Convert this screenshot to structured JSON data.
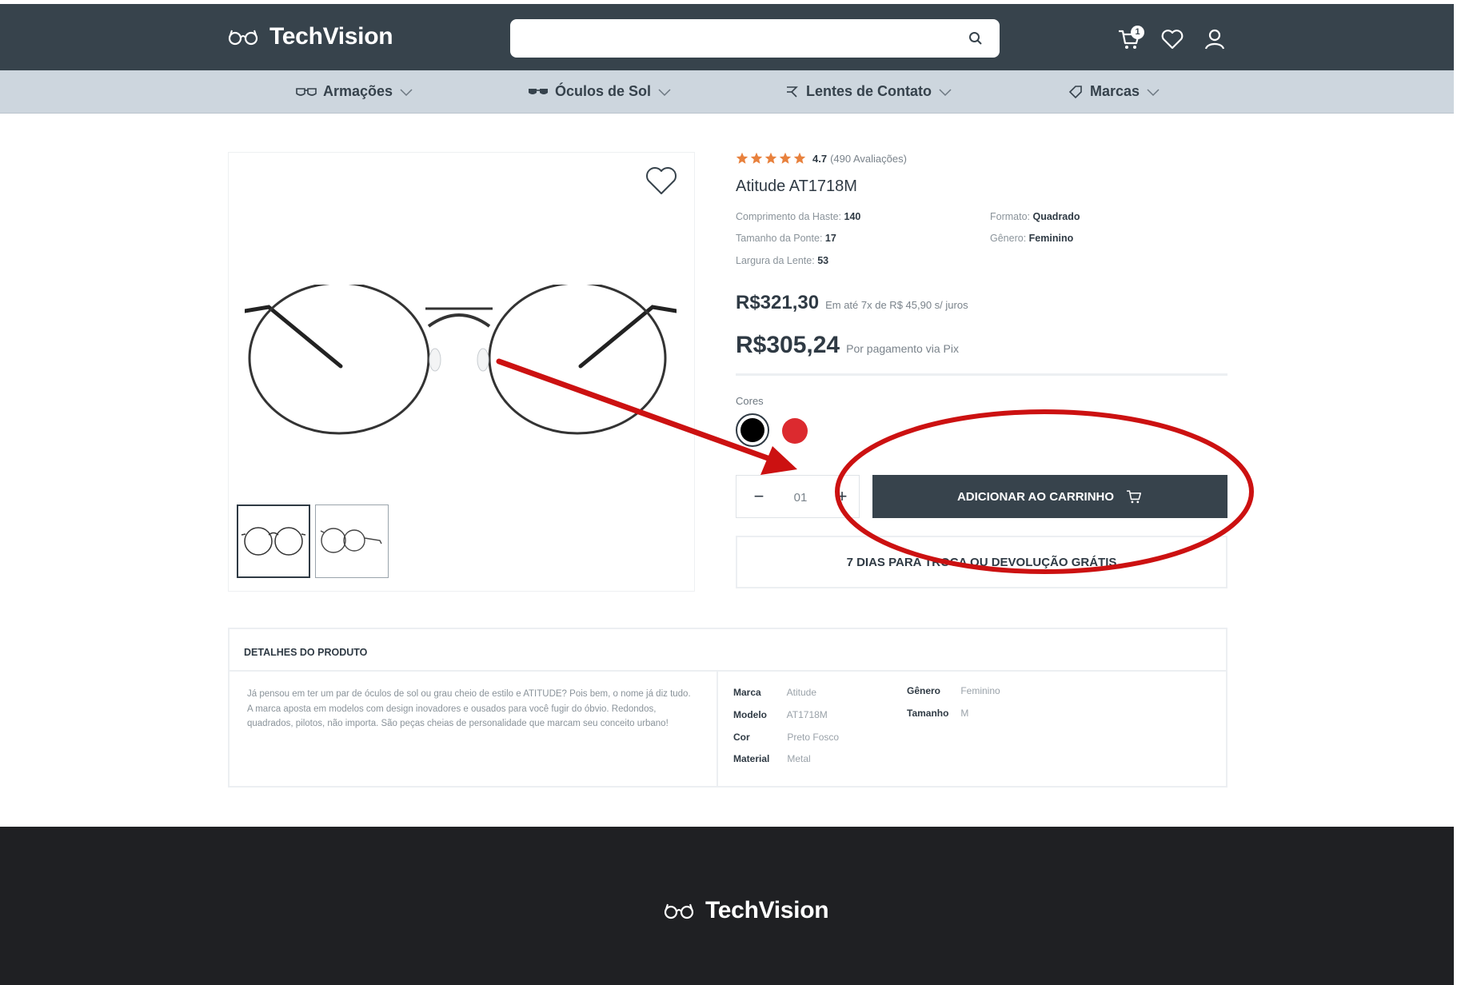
{
  "header": {
    "brand": "TechVision",
    "search_placeholder": "",
    "cart_count": "1"
  },
  "icons": {
    "logo": "glasses-icon",
    "search": "search-icon",
    "cart": "cart-icon",
    "wishlist": "heart-icon",
    "account": "user-icon"
  },
  "categories": [
    {
      "label": "Armações",
      "icon": "frames-icon"
    },
    {
      "label": "Óculos de Sol",
      "icon": "sunglasses-icon"
    },
    {
      "label": "Lentes de Contato",
      "icon": "contact-lens-icon"
    },
    {
      "label": "Marcas",
      "icon": "tag-icon"
    }
  ],
  "product": {
    "rating": "4.7",
    "rating_count": "(490 Avaliações)",
    "title": "Atitude AT1718M",
    "specs": [
      {
        "label": "Comprimento da Haste:",
        "value": "140"
      },
      {
        "label": "Tamanho da Ponte:",
        "value": "17"
      },
      {
        "label": "Largura da Lente:",
        "value": "53"
      },
      {
        "label": "Formato:",
        "value": "Quadrado"
      },
      {
        "label": "Gênero:",
        "value": "Feminino"
      }
    ],
    "price": "R$321,30",
    "installments": "Em até 7x de R$ 45,90 s/ juros",
    "pix_price": "R$305,24",
    "pix_note": "Por pagamento via Pix",
    "colors_label": "Cores",
    "colors": [
      "#000000",
      "#dc2a2f"
    ],
    "quantity": "01",
    "quantity_minus": "−",
    "quantity_plus": "+",
    "add_to_cart": "ADICIONAR AO CARRINHO",
    "returns": "7 DIAS PARA TROCA OU DEVOLUÇÃO GRÁTIS"
  },
  "details": {
    "title": "DETALHES DO PRODUTO",
    "description": "Já pensou em ter um par de óculos de sol ou grau cheio de estilo e ATITUDE? Pois bem, o nome já diz tudo. A marca aposta em modelos com design inovadores e ousados para você fugir do óbvio. Redondos, quadrados, pilotos, não importa. São peças cheias de personalidade que marcam seu conceito urbano!",
    "attributes": [
      {
        "key": "Marca",
        "value": "Atitude"
      },
      {
        "key": "Modelo",
        "value": "AT1718M"
      },
      {
        "key": "Cor",
        "value": "Preto Fosco"
      },
      {
        "key": "Material",
        "value": "Metal"
      },
      {
        "key": "Gênero",
        "value": "Feminino"
      },
      {
        "key": "Tamanho",
        "value": "M"
      }
    ]
  },
  "footer": {
    "brand": "TechVision"
  },
  "annotation": {
    "color": "#cc1111"
  }
}
